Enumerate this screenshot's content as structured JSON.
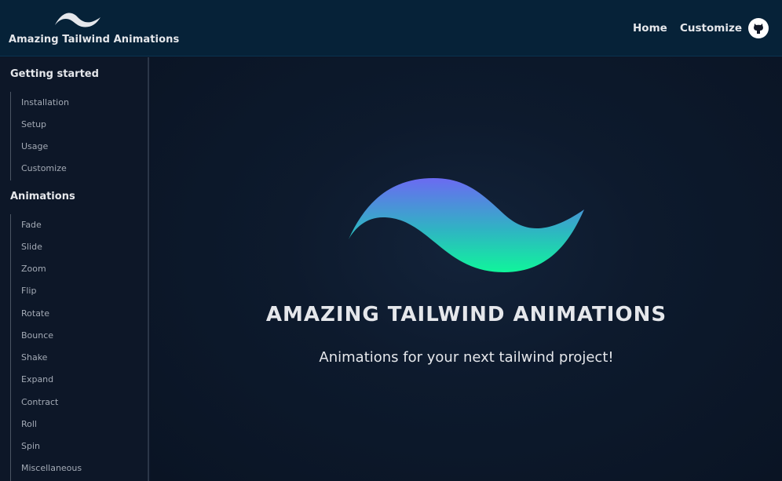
{
  "header": {
    "brand_name": "Amazing Tailwind Animations",
    "nav": {
      "home": "Home",
      "customize": "Customize"
    },
    "github_icon": "github-icon"
  },
  "sidebar": {
    "sections": [
      {
        "title": "Getting started",
        "items": [
          "Installation",
          "Setup",
          "Usage",
          "Customize"
        ]
      },
      {
        "title": "Animations",
        "items": [
          "Fade",
          "Slide",
          "Zoom",
          "Flip",
          "Rotate",
          "Bounce",
          "Shake",
          "Expand",
          "Contract",
          "Roll",
          "Spin",
          "Miscellaneous"
        ]
      }
    ]
  },
  "hero": {
    "title": "AMAZING TAILWIND ANIMATIONS",
    "subtitle": "Animations for your next tailwind project!",
    "logo_icon": "tailwind-wave-logo-icon"
  },
  "colors": {
    "header_bg": "#062238",
    "sidebar_bg": "#0d1728",
    "main_bg": "#0d1a2d",
    "gradient_top": "#6366f1",
    "gradient_bottom": "#10f0a0"
  }
}
